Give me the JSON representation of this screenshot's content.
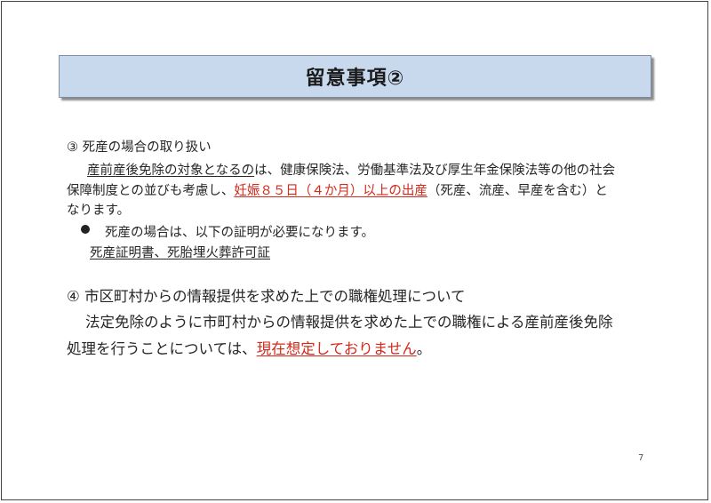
{
  "title": "留意事項②",
  "section3": {
    "heading": "③ 死産の場合の取り扱い",
    "para_a": "産前産後免除の対象となるの",
    "para_b": "は、健康保険法、労働基準法及び厚生年金保険法等の他の社会",
    "para_c": "保障制度との並びも考慮し、",
    "para_d": "妊娠８５日（４か月）以上の出産",
    "para_e": "（死産、流産、早産を含む）と",
    "para_f": "なります。",
    "bullet_text": "死産の場合は、以下の証明が必要になります。",
    "docs": "死産証明書、死胎埋火葬許可証"
  },
  "section4": {
    "heading": "④ 市区町村からの情報提供を求めた上での職権処理について",
    "para_a": "法定免除のように市町村からの情報提供を求めた上での職権による産前産後免除",
    "para_b": "処理を行うことについては、",
    "para_c": "現在想定しておりません",
    "para_d": "。"
  },
  "page_number": "7",
  "colors": {
    "title_bg": "#c8d9ee",
    "emphasis_red": "#d42a1c"
  }
}
